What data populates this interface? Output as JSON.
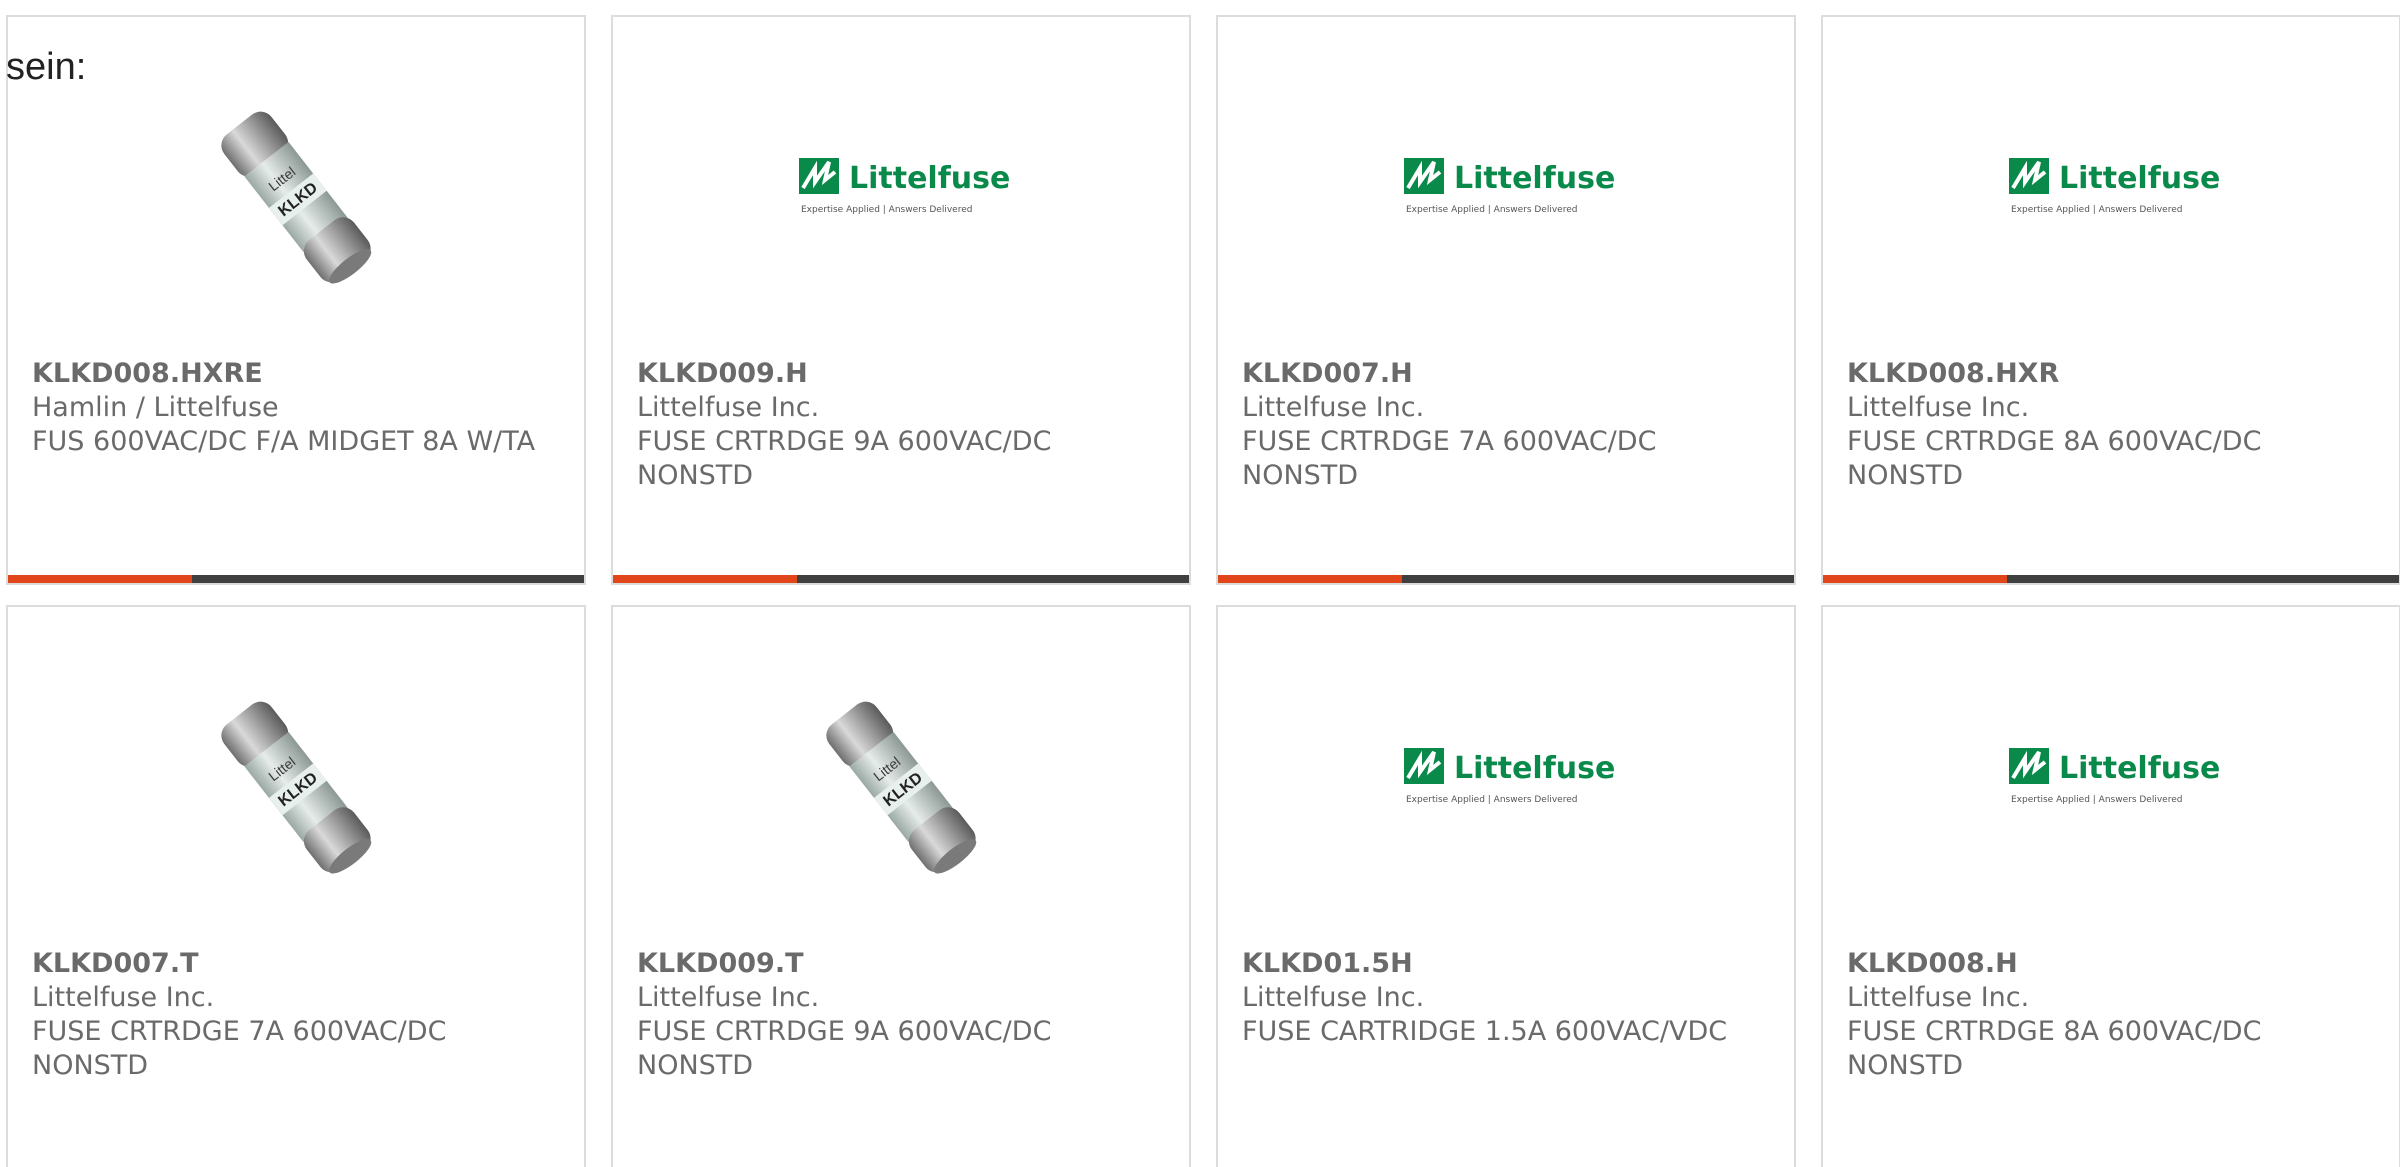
{
  "intro_text": "sein:",
  "colors": {
    "accent": "#e0461a",
    "bar": "#3f3f3f",
    "text": "#6a6a6a",
    "border": "#dcdcdc",
    "logo_green": "#0a8a4a"
  },
  "products": [
    {
      "part_number": "KLKD008.HXRE",
      "manufacturer": "Hamlin / Littelfuse",
      "description": "FUS 600VAC/DC F/A MIDGET 8A W/TA",
      "image": "fuse-photo",
      "progress": 0.32
    },
    {
      "part_number": "KLKD009.H",
      "manufacturer": "Littelfuse Inc.",
      "description": "FUSE CRTRDGE 9A 600VAC/DC NONSTD",
      "image": "littelfuse-logo",
      "progress": 0.32
    },
    {
      "part_number": "KLKD007.H",
      "manufacturer": "Littelfuse Inc.",
      "description": "FUSE CRTRDGE 7A 600VAC/DC NONSTD",
      "image": "littelfuse-logo",
      "progress": 0.32
    },
    {
      "part_number": "KLKD008.HXR",
      "manufacturer": "Littelfuse Inc.",
      "description": "FUSE CRTRDGE 8A 600VAC/DC NONSTD",
      "image": "littelfuse-logo",
      "progress": 0.32
    },
    {
      "part_number": "KLKD007.T",
      "manufacturer": "Littelfuse Inc.",
      "description": "FUSE CRTRDGE 7A 600VAC/DC NONSTD",
      "image": "fuse-photo",
      "progress": 0
    },
    {
      "part_number": "KLKD009.T",
      "manufacturer": "Littelfuse Inc.",
      "description": "FUSE CRTRDGE 9A 600VAC/DC NONSTD",
      "image": "fuse-photo",
      "progress": 0
    },
    {
      "part_number": "KLKD01.5H",
      "manufacturer": "Littelfuse Inc.",
      "description": "FUSE CARTRIDGE 1.5A 600VAC/VDC",
      "image": "littelfuse-logo",
      "progress": 0
    },
    {
      "part_number": "KLKD008.H",
      "manufacturer": "Littelfuse Inc.",
      "description": "FUSE CRTRDGE 8A 600VAC/DC NONSTD",
      "image": "littelfuse-logo",
      "progress": 0
    }
  ],
  "logo": {
    "brand": "Littelfuse",
    "tagline": "Expertise Applied | Answers Delivered"
  }
}
